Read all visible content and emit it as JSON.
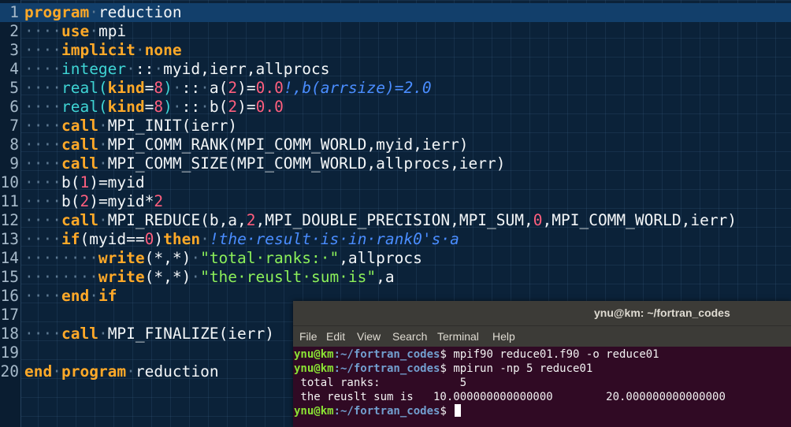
{
  "editor": {
    "lines": [
      {
        "num": "1",
        "indent": "",
        "tokens": [
          [
            "kw",
            "program"
          ],
          [
            "dots",
            "·"
          ],
          [
            "op",
            "reduction"
          ]
        ],
        "current": true
      },
      {
        "num": "2",
        "indent": "····",
        "tokens": [
          [
            "kw",
            "use"
          ],
          [
            "dots",
            "·"
          ],
          [
            "op",
            "mpi"
          ]
        ]
      },
      {
        "num": "3",
        "indent": "····",
        "tokens": [
          [
            "kw",
            "implicit"
          ],
          [
            "dots",
            "·"
          ],
          [
            "kw",
            "none"
          ]
        ]
      },
      {
        "num": "4",
        "indent": "····",
        "tokens": [
          [
            "ty",
            "integer"
          ],
          [
            "dots",
            "·"
          ],
          [
            "op",
            "::"
          ],
          [
            "dots",
            "·"
          ],
          [
            "op",
            "myid,ierr,allprocs"
          ]
        ]
      },
      {
        "num": "5",
        "indent": "····",
        "tokens": [
          [
            "ty",
            "real("
          ],
          [
            "kw",
            "kind"
          ],
          [
            "op",
            "="
          ],
          [
            "num",
            "8"
          ],
          [
            "ty",
            ")"
          ],
          [
            "dots",
            "·"
          ],
          [
            "op",
            "::"
          ],
          [
            "dots",
            "·"
          ],
          [
            "op",
            "a("
          ],
          [
            "num",
            "2"
          ],
          [
            "op",
            ")="
          ],
          [
            "num",
            "0.0"
          ],
          [
            "cm",
            "!,b(arrsize)=2.0"
          ]
        ]
      },
      {
        "num": "6",
        "indent": "····",
        "tokens": [
          [
            "ty",
            "real("
          ],
          [
            "kw",
            "kind"
          ],
          [
            "op",
            "="
          ],
          [
            "num",
            "8"
          ],
          [
            "ty",
            ")"
          ],
          [
            "dots",
            "·"
          ],
          [
            "op",
            "::"
          ],
          [
            "dots",
            "·"
          ],
          [
            "op",
            "b("
          ],
          [
            "num",
            "2"
          ],
          [
            "op",
            ")="
          ],
          [
            "num",
            "0.0"
          ]
        ]
      },
      {
        "num": "7",
        "indent": "····",
        "tokens": [
          [
            "kw",
            "call"
          ],
          [
            "dots",
            "·"
          ],
          [
            "op",
            "MPI_INIT(ierr)"
          ]
        ]
      },
      {
        "num": "8",
        "indent": "····",
        "tokens": [
          [
            "kw",
            "call"
          ],
          [
            "dots",
            "·"
          ],
          [
            "op",
            "MPI_COMM_RANK(MPI_COMM_WORLD,myid,ierr)"
          ]
        ]
      },
      {
        "num": "9",
        "indent": "····",
        "tokens": [
          [
            "kw",
            "call"
          ],
          [
            "dots",
            "·"
          ],
          [
            "op",
            "MPI_COMM_SIZE(MPI_COMM_WORLD,allprocs,ierr)"
          ]
        ]
      },
      {
        "num": "10",
        "indent": "····",
        "tokens": [
          [
            "op",
            "b("
          ],
          [
            "num",
            "1"
          ],
          [
            "op",
            ")=myid"
          ]
        ]
      },
      {
        "num": "11",
        "indent": "····",
        "tokens": [
          [
            "op",
            "b("
          ],
          [
            "num",
            "2"
          ],
          [
            "op",
            ")=myid*"
          ],
          [
            "num",
            "2"
          ]
        ]
      },
      {
        "num": "12",
        "indent": "····",
        "tokens": [
          [
            "kw",
            "call"
          ],
          [
            "dots",
            "·"
          ],
          [
            "op",
            "MPI_REDUCE(b,a,"
          ],
          [
            "num",
            "2"
          ],
          [
            "op",
            ",MPI_DOUBLE_PRECISION,MPI_SUM,"
          ],
          [
            "num",
            "0"
          ],
          [
            "op",
            ",MPI_COMM_WORLD,ierr)"
          ]
        ]
      },
      {
        "num": "13",
        "indent": "····",
        "tokens": [
          [
            "kw",
            "if"
          ],
          [
            "op",
            "(myid=="
          ],
          [
            "num",
            "0"
          ],
          [
            "op",
            ")"
          ],
          [
            "kw",
            "then"
          ],
          [
            "dots",
            "·"
          ],
          [
            "cm",
            "!the·result·is·in·rank0's·a"
          ]
        ]
      },
      {
        "num": "14",
        "indent": "········",
        "tokens": [
          [
            "kw",
            "write"
          ],
          [
            "op",
            "(*,*)"
          ],
          [
            "dots",
            "·"
          ],
          [
            "str",
            "\"total·ranks:·\""
          ],
          [
            "op",
            ",allprocs"
          ]
        ]
      },
      {
        "num": "15",
        "indent": "········",
        "tokens": [
          [
            "kw",
            "write"
          ],
          [
            "op",
            "(*,*)"
          ],
          [
            "dots",
            "·"
          ],
          [
            "str",
            "\"the·reuslt·sum·is\""
          ],
          [
            "op",
            ",a"
          ]
        ]
      },
      {
        "num": "16",
        "indent": "····",
        "tokens": [
          [
            "kw",
            "end"
          ],
          [
            "dots",
            "·"
          ],
          [
            "kw",
            "if"
          ]
        ]
      },
      {
        "num": "17",
        "indent": "",
        "tokens": []
      },
      {
        "num": "18",
        "indent": "····",
        "tokens": [
          [
            "kw",
            "call"
          ],
          [
            "dots",
            "·"
          ],
          [
            "op",
            "MPI_FINALIZE(ierr)"
          ]
        ]
      },
      {
        "num": "19",
        "indent": "",
        "tokens": []
      },
      {
        "num": "20",
        "indent": "",
        "tokens": [
          [
            "kw",
            "end"
          ],
          [
            "dots",
            "·"
          ],
          [
            "kw",
            "program"
          ],
          [
            "dots",
            "·"
          ],
          [
            "op",
            "reduction"
          ]
        ]
      }
    ]
  },
  "terminal": {
    "title": "ynu@km: ~/fortran_codes",
    "menu": [
      "File",
      "Edit",
      "View",
      "Search",
      "Terminal",
      "Help"
    ],
    "prompt_user": "ynu@km",
    "prompt_path": ":~/fortran_codes",
    "prompt_symbol": "$",
    "commands": [
      "mpif90 reduce01.f90 -o reduce01",
      "mpirun -np 5 reduce01"
    ],
    "output": [
      " total ranks:            5",
      " the reuslt sum is   10.000000000000000        20.000000000000000"
    ]
  },
  "colors": {
    "editor_bg": "#0b2239",
    "keyword": "#ffa928",
    "type": "#3fd5d5",
    "number": "#ff5f7e",
    "string": "#8cf05a",
    "comment": "#4a8dff",
    "terminal_bg": "#300a24",
    "prompt_user": "#8ae234",
    "prompt_path": "#729fcf"
  }
}
